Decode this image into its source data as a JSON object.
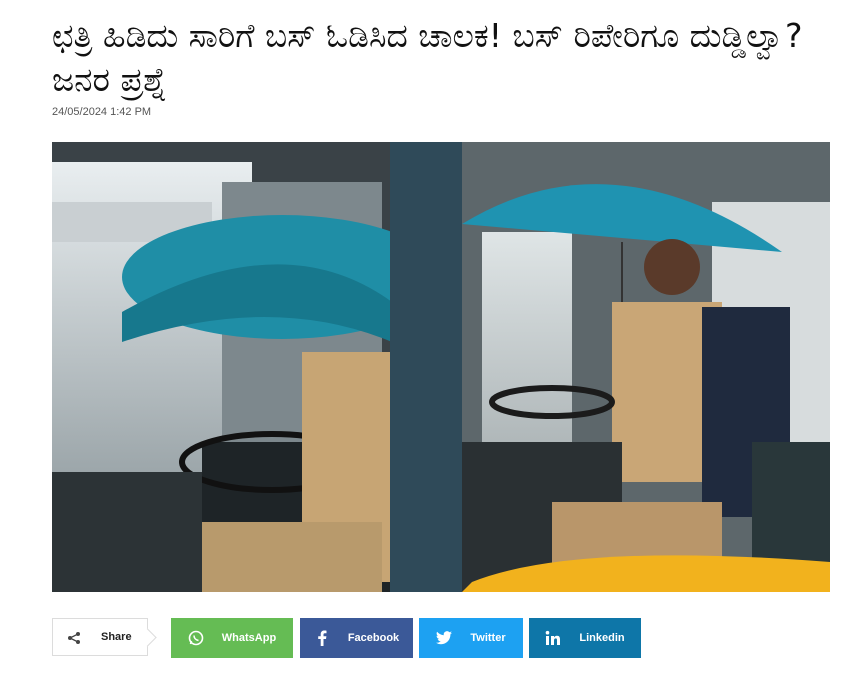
{
  "article": {
    "headline": "ಛತ್ರಿ ಹಿಡಿದು ಸಾರಿಗೆ ಬಸ್ ಓಡಿಸಿದ ಚಾಲಕ! ಬಸ್ ರಿಪೇರಿಗೂ ದುಡ್ಡಿಲ್ವಾ? ಜನರ ಪ್ರಶ್ನೆ",
    "timestamp": "24/05/2024 1:42 PM"
  },
  "share": {
    "toggle_label": "Share",
    "buttons": [
      {
        "label": "WhatsApp",
        "icon": "whatsapp-icon",
        "color": "#65bc54"
      },
      {
        "label": "Facebook",
        "icon": "facebook-icon",
        "color": "#3b5998"
      },
      {
        "label": "Twitter",
        "icon": "twitter-icon",
        "color": "#1da1f2"
      },
      {
        "label": "Linkedin",
        "icon": "linkedin-icon",
        "color": "#0e76a8"
      }
    ]
  }
}
